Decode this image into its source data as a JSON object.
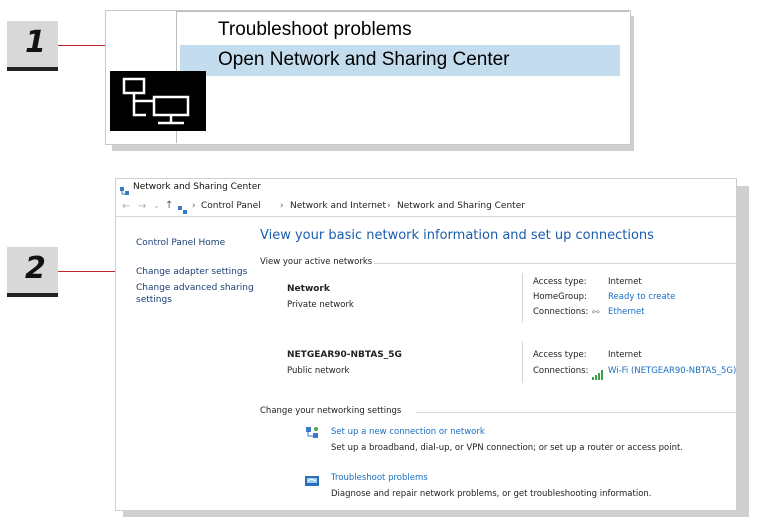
{
  "steps": {
    "one": "1",
    "two": "2"
  },
  "context_menu": {
    "items": [
      "Troubleshoot problems",
      "Open Network and Sharing Center"
    ]
  },
  "window": {
    "title": "Network and Sharing Center",
    "breadcrumb": [
      "Control Panel",
      "Network and Internet",
      "Network and Sharing Center"
    ],
    "sidebar": {
      "home": "Control Panel Home",
      "items": [
        "Change adapter settings",
        "Change advanced sharing",
        "settings"
      ]
    },
    "heading": "View your basic network information and set up connections",
    "active_label": "View your active networks",
    "networks": [
      {
        "name": "Network",
        "kind": "Private network",
        "access_label": "Access type:",
        "access_value": "Internet",
        "homegroup_label": "HomeGroup:",
        "homegroup_value": "Ready to create",
        "conn_label": "Connections:",
        "conn_value": "Ethernet"
      },
      {
        "name": "NETGEAR90-NBTAS_5G",
        "kind": "Public network",
        "access_label": "Access type:",
        "access_value": "Internet",
        "conn_label": "Connections:",
        "conn_value": "Wi-Fi (NETGEAR90-NBTAS_5G)"
      }
    ],
    "change_label": "Change your networking settings",
    "tasks": [
      {
        "title": "Set up a new connection or network",
        "desc": "Set up a broadband, dial-up, or VPN connection; or set up a router or access point."
      },
      {
        "title": "Troubleshoot problems",
        "desc": "Diagnose and repair network problems, or get troubleshooting information."
      }
    ]
  },
  "colors": {
    "link": "#1a6ec2",
    "callout": "#c0282d",
    "highlight": "#c3ddef"
  }
}
